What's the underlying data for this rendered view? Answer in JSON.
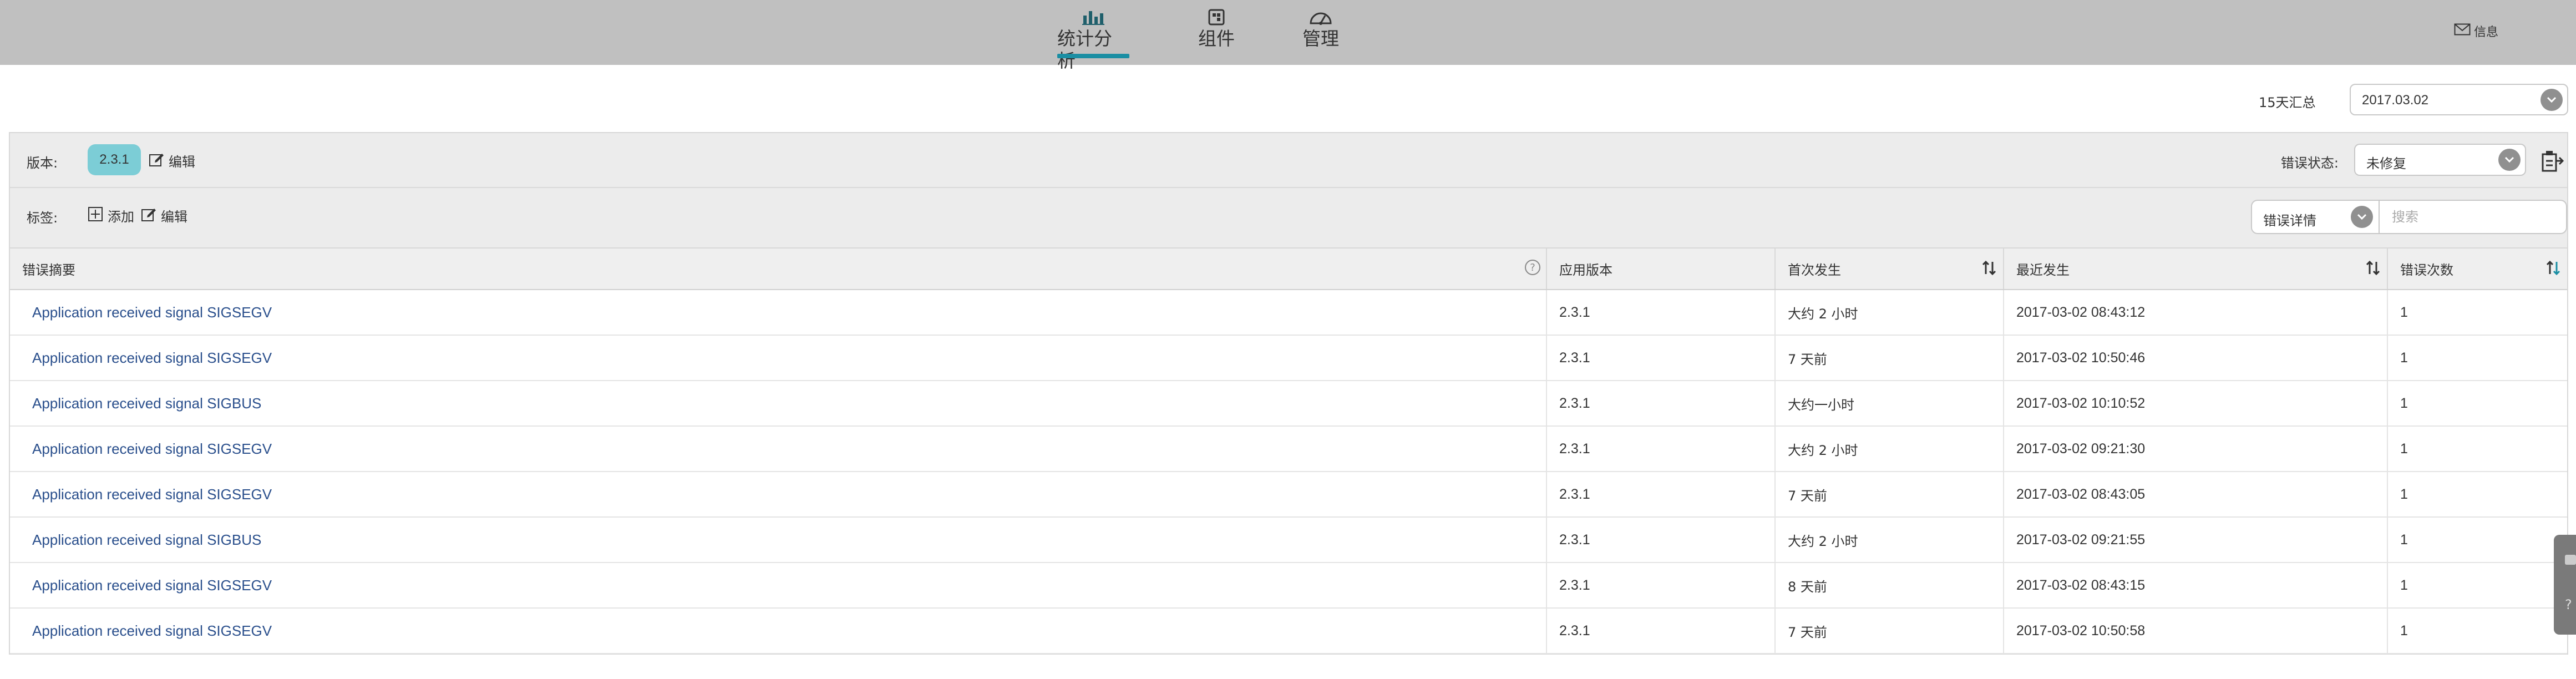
{
  "nav": {
    "items": [
      {
        "label": "统计分析",
        "icon": "bar-chart-icon",
        "active": true
      },
      {
        "label": "组件",
        "icon": "component-icon",
        "active": false
      },
      {
        "label": "管理",
        "icon": "dashboard-gauge-icon",
        "active": false
      }
    ],
    "messages_label": "信息",
    "active_color": "#1a8ea3"
  },
  "summary": {
    "label": "15天汇总",
    "date": "2017.03.02"
  },
  "filters": {
    "version_label": "版本:",
    "version_value": "2.3.1",
    "edit_label": "编辑",
    "tags_label": "标签:",
    "add_label": "添加",
    "tags_edit_label": "编辑",
    "status_label": "错误状态:",
    "status_value": "未修复",
    "detail_value": "错误详情",
    "search_placeholder": "搜索"
  },
  "table": {
    "headers": [
      "错误摘要",
      "应用版本",
      "首次发生",
      "最近发生",
      "错误次数"
    ],
    "rows": [
      {
        "summary": "Application received signal SIGSEGV",
        "version": "2.3.1",
        "first": "大约 2 小时",
        "last": "2017-03-02 08:43:12",
        "count": "1"
      },
      {
        "summary": "Application received signal SIGSEGV",
        "version": "2.3.1",
        "first": "7 天前",
        "last": "2017-03-02 10:50:46",
        "count": "1"
      },
      {
        "summary": "Application received signal SIGBUS",
        "version": "2.3.1",
        "first": "大约一小时",
        "last": "2017-03-02 10:10:52",
        "count": "1"
      },
      {
        "summary": "Application received signal SIGSEGV",
        "version": "2.3.1",
        "first": "大约 2 小时",
        "last": "2017-03-02 09:21:30",
        "count": "1"
      },
      {
        "summary": "Application received signal SIGSEGV",
        "version": "2.3.1",
        "first": "7 天前",
        "last": "2017-03-02 08:43:05",
        "count": "1"
      },
      {
        "summary": "Application received signal SIGBUS",
        "version": "2.3.1",
        "first": "大约 2 小时",
        "last": "2017-03-02 09:21:55",
        "count": "1"
      },
      {
        "summary": "Application received signal SIGSEGV",
        "version": "2.3.1",
        "first": "8 天前",
        "last": "2017-03-02 08:43:15",
        "count": "1"
      },
      {
        "summary": "Application received signal SIGSEGV",
        "version": "2.3.1",
        "first": "7 天前",
        "last": "2017-03-02 10:50:58",
        "count": "1"
      }
    ]
  },
  "side_tab": {
    "help_glyph": "?"
  }
}
